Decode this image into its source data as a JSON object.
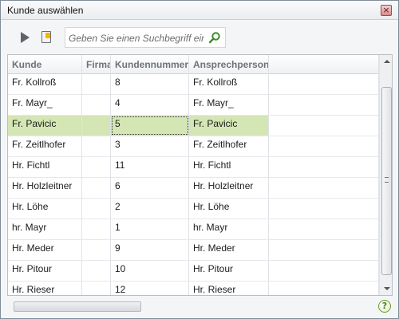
{
  "window": {
    "title": "Kunde auswählen",
    "close_glyph": "×"
  },
  "toolbar": {
    "play_icon": "play-icon",
    "notepad_icon": "notepad-icon"
  },
  "search": {
    "placeholder": "Geben Sie einen Suchbegriff ein",
    "value": ""
  },
  "grid": {
    "columns": [
      "Kunde",
      "Firma",
      "Kundennummer",
      "Ansprechperson"
    ],
    "rows": [
      {
        "kunde": "Fr. Kollroß",
        "firma": "",
        "nummer": "8",
        "ansprechperson": "Fr. Kollroß"
      },
      {
        "kunde": "Fr. Mayr_",
        "firma": "",
        "nummer": "4",
        "ansprechperson": "Fr. Mayr_"
      },
      {
        "kunde": "Fr. Pavicic",
        "firma": "",
        "nummer": "5",
        "ansprechperson": "Fr. Pavicic"
      },
      {
        "kunde": "Fr. Zeitlhofer",
        "firma": "",
        "nummer": "3",
        "ansprechperson": "Fr. Zeitlhofer"
      },
      {
        "kunde": "Hr. Fichtl",
        "firma": "",
        "nummer": "11",
        "ansprechperson": "Hr. Fichtl"
      },
      {
        "kunde": "Hr. Holzleitner",
        "firma": "",
        "nummer": "6",
        "ansprechperson": "Hr. Holzleitner"
      },
      {
        "kunde": "Hr. Löhe",
        "firma": "",
        "nummer": "2",
        "ansprechperson": "Hr. Löhe"
      },
      {
        "kunde": "hr. Mayr",
        "firma": "",
        "nummer": "1",
        "ansprechperson": "hr. Mayr"
      },
      {
        "kunde": "Hr. Meder",
        "firma": "",
        "nummer": "9",
        "ansprechperson": "Hr. Meder"
      },
      {
        "kunde": "Hr. Pitour",
        "firma": "",
        "nummer": "10",
        "ansprechperson": "Hr. Pitour"
      },
      {
        "kunde": "Hr. Rieser",
        "firma": "",
        "nummer": "12",
        "ansprechperson": "Hr. Rieser"
      }
    ],
    "selected_row": 2
  },
  "footer": {
    "help_glyph": "?"
  },
  "colors": {
    "selection": "#d4e6b4",
    "help_green": "#6d9a2e"
  }
}
